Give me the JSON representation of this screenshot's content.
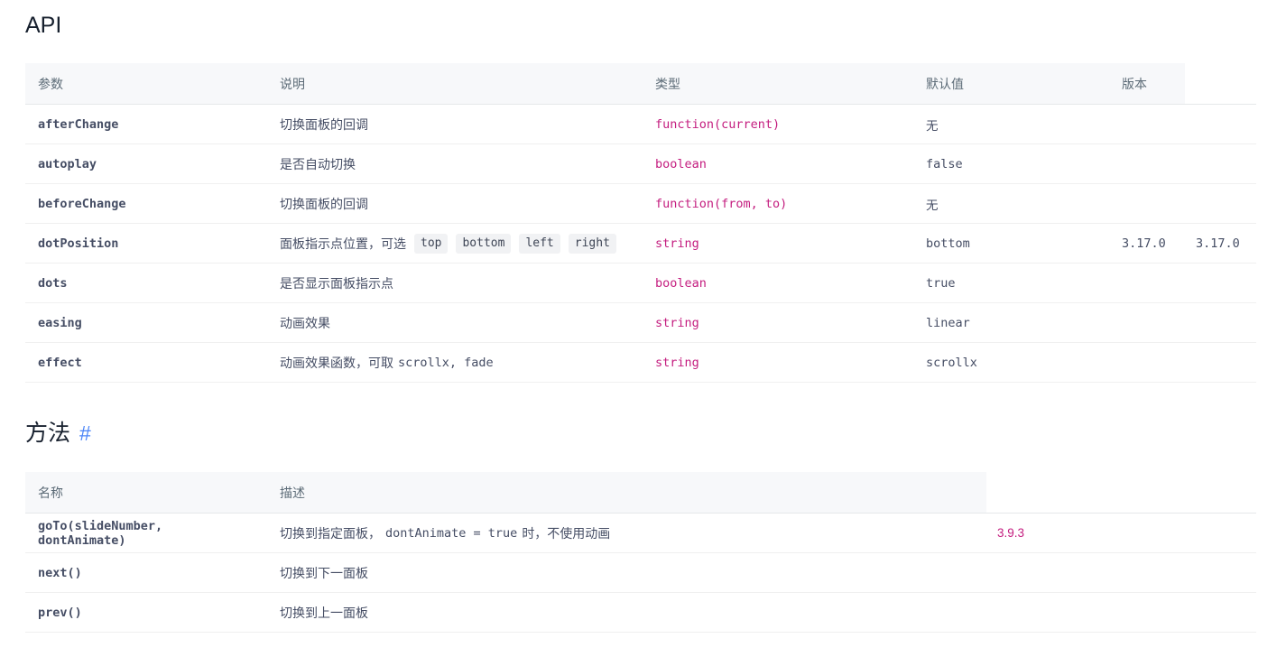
{
  "page": {
    "api_title": "API",
    "methods_title": "方法",
    "anchor_symbol": "#"
  },
  "colors": {
    "anchor_link_blue": "#4d86f8",
    "code_magenta": "#c41d7f",
    "table_header_bg": "#f7f8fa",
    "row_border": "#f0f0f0"
  },
  "api_table": {
    "headers": [
      "参数",
      "说明",
      "类型",
      "默认值",
      "版本",
      ""
    ],
    "rows": [
      {
        "param": "afterChange",
        "desc": [
          {
            "kind": "text",
            "value": "切换面板的回调"
          }
        ],
        "type": "function(current)",
        "default": "无",
        "version": "",
        "version_extra": ""
      },
      {
        "param": "autoplay",
        "desc": [
          {
            "kind": "text",
            "value": "是否自动切换"
          }
        ],
        "type": "boolean",
        "default": "false",
        "version": "",
        "version_extra": ""
      },
      {
        "param": "beforeChange",
        "desc": [
          {
            "kind": "text",
            "value": "切换面板的回调"
          }
        ],
        "type": "function(from, to)",
        "default": "无",
        "version": "",
        "version_extra": ""
      },
      {
        "param": "dotPosition",
        "desc": [
          {
            "kind": "text",
            "value": "面板指示点位置，可选"
          },
          {
            "kind": "tag",
            "value": "top"
          },
          {
            "kind": "tag",
            "value": "bottom"
          },
          {
            "kind": "tag",
            "value": "left"
          },
          {
            "kind": "tag",
            "value": "right"
          }
        ],
        "type": "string",
        "default": "bottom",
        "version": "3.17.0",
        "version_extra": "3.17.0"
      },
      {
        "param": "dots",
        "desc": [
          {
            "kind": "text",
            "value": "是否显示面板指示点"
          }
        ],
        "type": "boolean",
        "default": "true",
        "version": "",
        "version_extra": ""
      },
      {
        "param": "easing",
        "desc": [
          {
            "kind": "text",
            "value": "动画效果"
          }
        ],
        "type": "string",
        "default": "linear",
        "version": "",
        "version_extra": ""
      },
      {
        "param": "effect",
        "desc": [
          {
            "kind": "text",
            "value": "动画效果函数，可取"
          },
          {
            "kind": "mono",
            "value": "scrollx, fade"
          }
        ],
        "type": "string",
        "default": "scrollx",
        "version": "",
        "version_extra": ""
      }
    ]
  },
  "methods_table": {
    "headers": [
      "名称",
      "描述",
      ""
    ],
    "rows": [
      {
        "name": "goTo(slideNumber, dontAnimate)",
        "desc": [
          {
            "kind": "text",
            "value": "切换到指定面板，"
          },
          {
            "kind": "mono",
            "value": "dontAnimate = true"
          },
          {
            "kind": "text",
            "value": "时，不使用动画"
          }
        ],
        "version": "3.9.3"
      },
      {
        "name": "next()",
        "desc": [
          {
            "kind": "text",
            "value": "切换到下一面板"
          }
        ],
        "version": ""
      },
      {
        "name": "prev()",
        "desc": [
          {
            "kind": "text",
            "value": "切换到上一面板"
          }
        ],
        "version": ""
      }
    ]
  }
}
